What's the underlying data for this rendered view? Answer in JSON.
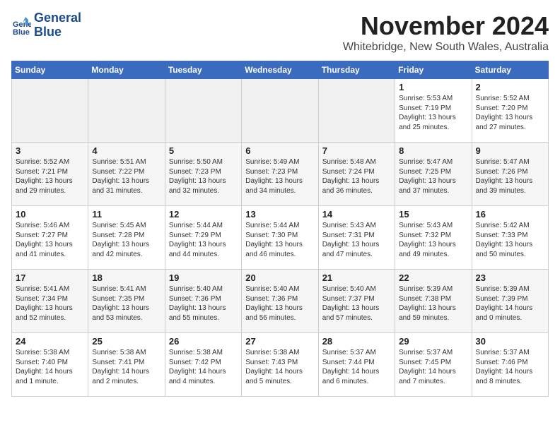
{
  "app": {
    "logo_line1": "General",
    "logo_line2": "Blue"
  },
  "header": {
    "month": "November 2024",
    "location": "Whitebridge, New South Wales, Australia"
  },
  "weekdays": [
    "Sunday",
    "Monday",
    "Tuesday",
    "Wednesday",
    "Thursday",
    "Friday",
    "Saturday"
  ],
  "weeks": [
    [
      {
        "day": "",
        "info": "",
        "empty": true
      },
      {
        "day": "",
        "info": "",
        "empty": true
      },
      {
        "day": "",
        "info": "",
        "empty": true
      },
      {
        "day": "",
        "info": "",
        "empty": true
      },
      {
        "day": "",
        "info": "",
        "empty": true
      },
      {
        "day": "1",
        "info": "Sunrise: 5:53 AM\nSunset: 7:19 PM\nDaylight: 13 hours\nand 25 minutes.",
        "empty": false
      },
      {
        "day": "2",
        "info": "Sunrise: 5:52 AM\nSunset: 7:20 PM\nDaylight: 13 hours\nand 27 minutes.",
        "empty": false
      }
    ],
    [
      {
        "day": "3",
        "info": "Sunrise: 5:52 AM\nSunset: 7:21 PM\nDaylight: 13 hours\nand 29 minutes.",
        "empty": false
      },
      {
        "day": "4",
        "info": "Sunrise: 5:51 AM\nSunset: 7:22 PM\nDaylight: 13 hours\nand 31 minutes.",
        "empty": false
      },
      {
        "day": "5",
        "info": "Sunrise: 5:50 AM\nSunset: 7:23 PM\nDaylight: 13 hours\nand 32 minutes.",
        "empty": false
      },
      {
        "day": "6",
        "info": "Sunrise: 5:49 AM\nSunset: 7:23 PM\nDaylight: 13 hours\nand 34 minutes.",
        "empty": false
      },
      {
        "day": "7",
        "info": "Sunrise: 5:48 AM\nSunset: 7:24 PM\nDaylight: 13 hours\nand 36 minutes.",
        "empty": false
      },
      {
        "day": "8",
        "info": "Sunrise: 5:47 AM\nSunset: 7:25 PM\nDaylight: 13 hours\nand 37 minutes.",
        "empty": false
      },
      {
        "day": "9",
        "info": "Sunrise: 5:47 AM\nSunset: 7:26 PM\nDaylight: 13 hours\nand 39 minutes.",
        "empty": false
      }
    ],
    [
      {
        "day": "10",
        "info": "Sunrise: 5:46 AM\nSunset: 7:27 PM\nDaylight: 13 hours\nand 41 minutes.",
        "empty": false
      },
      {
        "day": "11",
        "info": "Sunrise: 5:45 AM\nSunset: 7:28 PM\nDaylight: 13 hours\nand 42 minutes.",
        "empty": false
      },
      {
        "day": "12",
        "info": "Sunrise: 5:44 AM\nSunset: 7:29 PM\nDaylight: 13 hours\nand 44 minutes.",
        "empty": false
      },
      {
        "day": "13",
        "info": "Sunrise: 5:44 AM\nSunset: 7:30 PM\nDaylight: 13 hours\nand 46 minutes.",
        "empty": false
      },
      {
        "day": "14",
        "info": "Sunrise: 5:43 AM\nSunset: 7:31 PM\nDaylight: 13 hours\nand 47 minutes.",
        "empty": false
      },
      {
        "day": "15",
        "info": "Sunrise: 5:43 AM\nSunset: 7:32 PM\nDaylight: 13 hours\nand 49 minutes.",
        "empty": false
      },
      {
        "day": "16",
        "info": "Sunrise: 5:42 AM\nSunset: 7:33 PM\nDaylight: 13 hours\nand 50 minutes.",
        "empty": false
      }
    ],
    [
      {
        "day": "17",
        "info": "Sunrise: 5:41 AM\nSunset: 7:34 PM\nDaylight: 13 hours\nand 52 minutes.",
        "empty": false
      },
      {
        "day": "18",
        "info": "Sunrise: 5:41 AM\nSunset: 7:35 PM\nDaylight: 13 hours\nand 53 minutes.",
        "empty": false
      },
      {
        "day": "19",
        "info": "Sunrise: 5:40 AM\nSunset: 7:36 PM\nDaylight: 13 hours\nand 55 minutes.",
        "empty": false
      },
      {
        "day": "20",
        "info": "Sunrise: 5:40 AM\nSunset: 7:36 PM\nDaylight: 13 hours\nand 56 minutes.",
        "empty": false
      },
      {
        "day": "21",
        "info": "Sunrise: 5:40 AM\nSunset: 7:37 PM\nDaylight: 13 hours\nand 57 minutes.",
        "empty": false
      },
      {
        "day": "22",
        "info": "Sunrise: 5:39 AM\nSunset: 7:38 PM\nDaylight: 13 hours\nand 59 minutes.",
        "empty": false
      },
      {
        "day": "23",
        "info": "Sunrise: 5:39 AM\nSunset: 7:39 PM\nDaylight: 14 hours\nand 0 minutes.",
        "empty": false
      }
    ],
    [
      {
        "day": "24",
        "info": "Sunrise: 5:38 AM\nSunset: 7:40 PM\nDaylight: 14 hours\nand 1 minute.",
        "empty": false
      },
      {
        "day": "25",
        "info": "Sunrise: 5:38 AM\nSunset: 7:41 PM\nDaylight: 14 hours\nand 2 minutes.",
        "empty": false
      },
      {
        "day": "26",
        "info": "Sunrise: 5:38 AM\nSunset: 7:42 PM\nDaylight: 14 hours\nand 4 minutes.",
        "empty": false
      },
      {
        "day": "27",
        "info": "Sunrise: 5:38 AM\nSunset: 7:43 PM\nDaylight: 14 hours\nand 5 minutes.",
        "empty": false
      },
      {
        "day": "28",
        "info": "Sunrise: 5:37 AM\nSunset: 7:44 PM\nDaylight: 14 hours\nand 6 minutes.",
        "empty": false
      },
      {
        "day": "29",
        "info": "Sunrise: 5:37 AM\nSunset: 7:45 PM\nDaylight: 14 hours\nand 7 minutes.",
        "empty": false
      },
      {
        "day": "30",
        "info": "Sunrise: 5:37 AM\nSunset: 7:46 PM\nDaylight: 14 hours\nand 8 minutes.",
        "empty": false
      }
    ]
  ]
}
